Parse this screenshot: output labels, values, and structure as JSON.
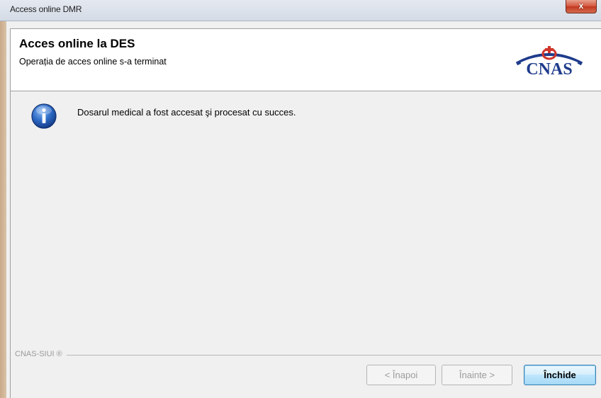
{
  "window": {
    "title": "Access online DMR",
    "close_glyph": "x"
  },
  "header": {
    "title": "Acces online la DES",
    "subtitle": "Operația de acces online s-a terminat",
    "logo_text": "CNAS"
  },
  "message": {
    "icon": "info-icon",
    "text": "Dosarul medical a fost accesat şi procesat cu succes."
  },
  "footer": {
    "label": "CNAS-SIUI ®"
  },
  "buttons": {
    "back": "< Înapoi",
    "next": "Înainte >",
    "close": "Închide"
  },
  "colors": {
    "accent": "#1e3b8c",
    "logo_red": "#d0352b"
  }
}
